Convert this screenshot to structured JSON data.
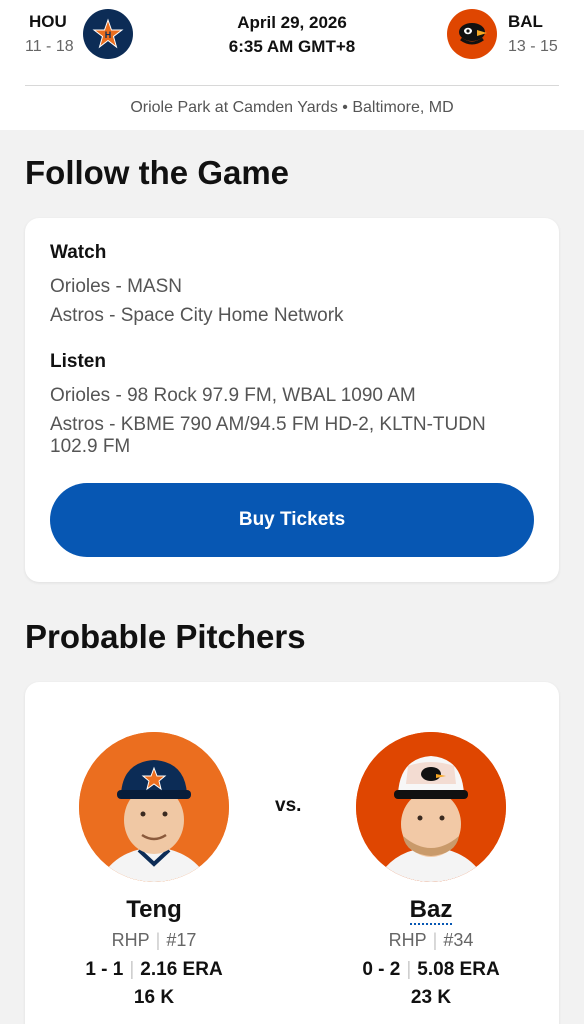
{
  "header": {
    "away": {
      "abbr": "HOU",
      "record": "11 - 18",
      "logo_icon": "astros-logo-icon",
      "color": "#0c2c56"
    },
    "home": {
      "abbr": "BAL",
      "record": "13 - 15",
      "logo_icon": "orioles-logo-icon",
      "color": "#df4601"
    },
    "date": "April 29, 2026",
    "time": "6:35 AM GMT+8",
    "venue": "Oriole Park at Camden Yards • Baltimore, MD"
  },
  "follow": {
    "title": "Follow the Game",
    "watch_label": "Watch",
    "watch": [
      "Orioles - MASN",
      "Astros - Space City Home Network"
    ],
    "listen_label": "Listen",
    "listen": [
      "Orioles - 98 Rock 97.9 FM, WBAL 1090 AM",
      "Astros - KBME 790 AM/94.5 FM HD-2, KLTN-TUDN 102.9 FM"
    ],
    "buy_label": "Buy Tickets",
    "accent": "#0757b3"
  },
  "pitchers": {
    "title": "Probable Pitchers",
    "vs": "vs.",
    "away": {
      "name": "Teng",
      "hand": "RHP",
      "number": "#17",
      "record": "1 - 1",
      "era": "2.16 ERA",
      "k": "16 K",
      "bg": "#eb6e1f"
    },
    "home": {
      "name": "Baz",
      "hand": "RHP",
      "number": "#34",
      "record": "0 - 2",
      "era": "5.08 ERA",
      "k": "23 K",
      "bg": "#df4601"
    }
  }
}
